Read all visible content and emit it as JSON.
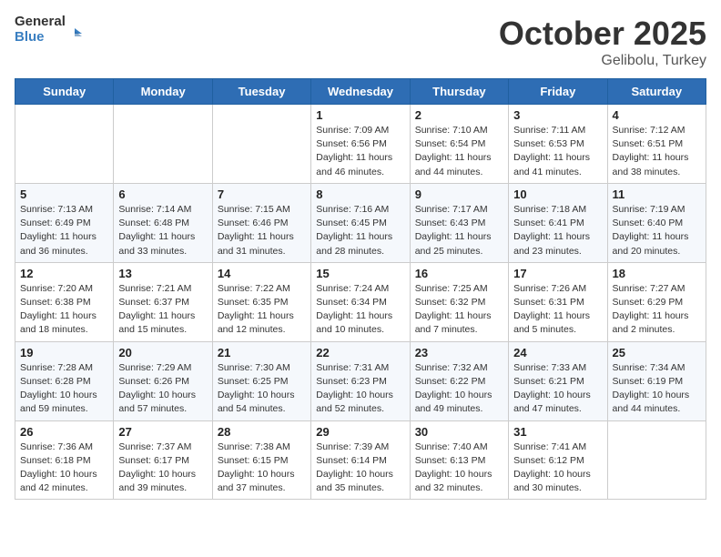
{
  "header": {
    "logo_general": "General",
    "logo_blue": "Blue",
    "month": "October 2025",
    "location": "Gelibolu, Turkey"
  },
  "days_of_week": [
    "Sunday",
    "Monday",
    "Tuesday",
    "Wednesday",
    "Thursday",
    "Friday",
    "Saturday"
  ],
  "weeks": [
    {
      "days": [
        {
          "num": "",
          "info": ""
        },
        {
          "num": "",
          "info": ""
        },
        {
          "num": "",
          "info": ""
        },
        {
          "num": "1",
          "info": "Sunrise: 7:09 AM\nSunset: 6:56 PM\nDaylight: 11 hours and 46 minutes."
        },
        {
          "num": "2",
          "info": "Sunrise: 7:10 AM\nSunset: 6:54 PM\nDaylight: 11 hours and 44 minutes."
        },
        {
          "num": "3",
          "info": "Sunrise: 7:11 AM\nSunset: 6:53 PM\nDaylight: 11 hours and 41 minutes."
        },
        {
          "num": "4",
          "info": "Sunrise: 7:12 AM\nSunset: 6:51 PM\nDaylight: 11 hours and 38 minutes."
        }
      ]
    },
    {
      "days": [
        {
          "num": "5",
          "info": "Sunrise: 7:13 AM\nSunset: 6:49 PM\nDaylight: 11 hours and 36 minutes."
        },
        {
          "num": "6",
          "info": "Sunrise: 7:14 AM\nSunset: 6:48 PM\nDaylight: 11 hours and 33 minutes."
        },
        {
          "num": "7",
          "info": "Sunrise: 7:15 AM\nSunset: 6:46 PM\nDaylight: 11 hours and 31 minutes."
        },
        {
          "num": "8",
          "info": "Sunrise: 7:16 AM\nSunset: 6:45 PM\nDaylight: 11 hours and 28 minutes."
        },
        {
          "num": "9",
          "info": "Sunrise: 7:17 AM\nSunset: 6:43 PM\nDaylight: 11 hours and 25 minutes."
        },
        {
          "num": "10",
          "info": "Sunrise: 7:18 AM\nSunset: 6:41 PM\nDaylight: 11 hours and 23 minutes."
        },
        {
          "num": "11",
          "info": "Sunrise: 7:19 AM\nSunset: 6:40 PM\nDaylight: 11 hours and 20 minutes."
        }
      ]
    },
    {
      "days": [
        {
          "num": "12",
          "info": "Sunrise: 7:20 AM\nSunset: 6:38 PM\nDaylight: 11 hours and 18 minutes."
        },
        {
          "num": "13",
          "info": "Sunrise: 7:21 AM\nSunset: 6:37 PM\nDaylight: 11 hours and 15 minutes."
        },
        {
          "num": "14",
          "info": "Sunrise: 7:22 AM\nSunset: 6:35 PM\nDaylight: 11 hours and 12 minutes."
        },
        {
          "num": "15",
          "info": "Sunrise: 7:24 AM\nSunset: 6:34 PM\nDaylight: 11 hours and 10 minutes."
        },
        {
          "num": "16",
          "info": "Sunrise: 7:25 AM\nSunset: 6:32 PM\nDaylight: 11 hours and 7 minutes."
        },
        {
          "num": "17",
          "info": "Sunrise: 7:26 AM\nSunset: 6:31 PM\nDaylight: 11 hours and 5 minutes."
        },
        {
          "num": "18",
          "info": "Sunrise: 7:27 AM\nSunset: 6:29 PM\nDaylight: 11 hours and 2 minutes."
        }
      ]
    },
    {
      "days": [
        {
          "num": "19",
          "info": "Sunrise: 7:28 AM\nSunset: 6:28 PM\nDaylight: 10 hours and 59 minutes."
        },
        {
          "num": "20",
          "info": "Sunrise: 7:29 AM\nSunset: 6:26 PM\nDaylight: 10 hours and 57 minutes."
        },
        {
          "num": "21",
          "info": "Sunrise: 7:30 AM\nSunset: 6:25 PM\nDaylight: 10 hours and 54 minutes."
        },
        {
          "num": "22",
          "info": "Sunrise: 7:31 AM\nSunset: 6:23 PM\nDaylight: 10 hours and 52 minutes."
        },
        {
          "num": "23",
          "info": "Sunrise: 7:32 AM\nSunset: 6:22 PM\nDaylight: 10 hours and 49 minutes."
        },
        {
          "num": "24",
          "info": "Sunrise: 7:33 AM\nSunset: 6:21 PM\nDaylight: 10 hours and 47 minutes."
        },
        {
          "num": "25",
          "info": "Sunrise: 7:34 AM\nSunset: 6:19 PM\nDaylight: 10 hours and 44 minutes."
        }
      ]
    },
    {
      "days": [
        {
          "num": "26",
          "info": "Sunrise: 7:36 AM\nSunset: 6:18 PM\nDaylight: 10 hours and 42 minutes."
        },
        {
          "num": "27",
          "info": "Sunrise: 7:37 AM\nSunset: 6:17 PM\nDaylight: 10 hours and 39 minutes."
        },
        {
          "num": "28",
          "info": "Sunrise: 7:38 AM\nSunset: 6:15 PM\nDaylight: 10 hours and 37 minutes."
        },
        {
          "num": "29",
          "info": "Sunrise: 7:39 AM\nSunset: 6:14 PM\nDaylight: 10 hours and 35 minutes."
        },
        {
          "num": "30",
          "info": "Sunrise: 7:40 AM\nSunset: 6:13 PM\nDaylight: 10 hours and 32 minutes."
        },
        {
          "num": "31",
          "info": "Sunrise: 7:41 AM\nSunset: 6:12 PM\nDaylight: 10 hours and 30 minutes."
        },
        {
          "num": "",
          "info": ""
        }
      ]
    }
  ]
}
